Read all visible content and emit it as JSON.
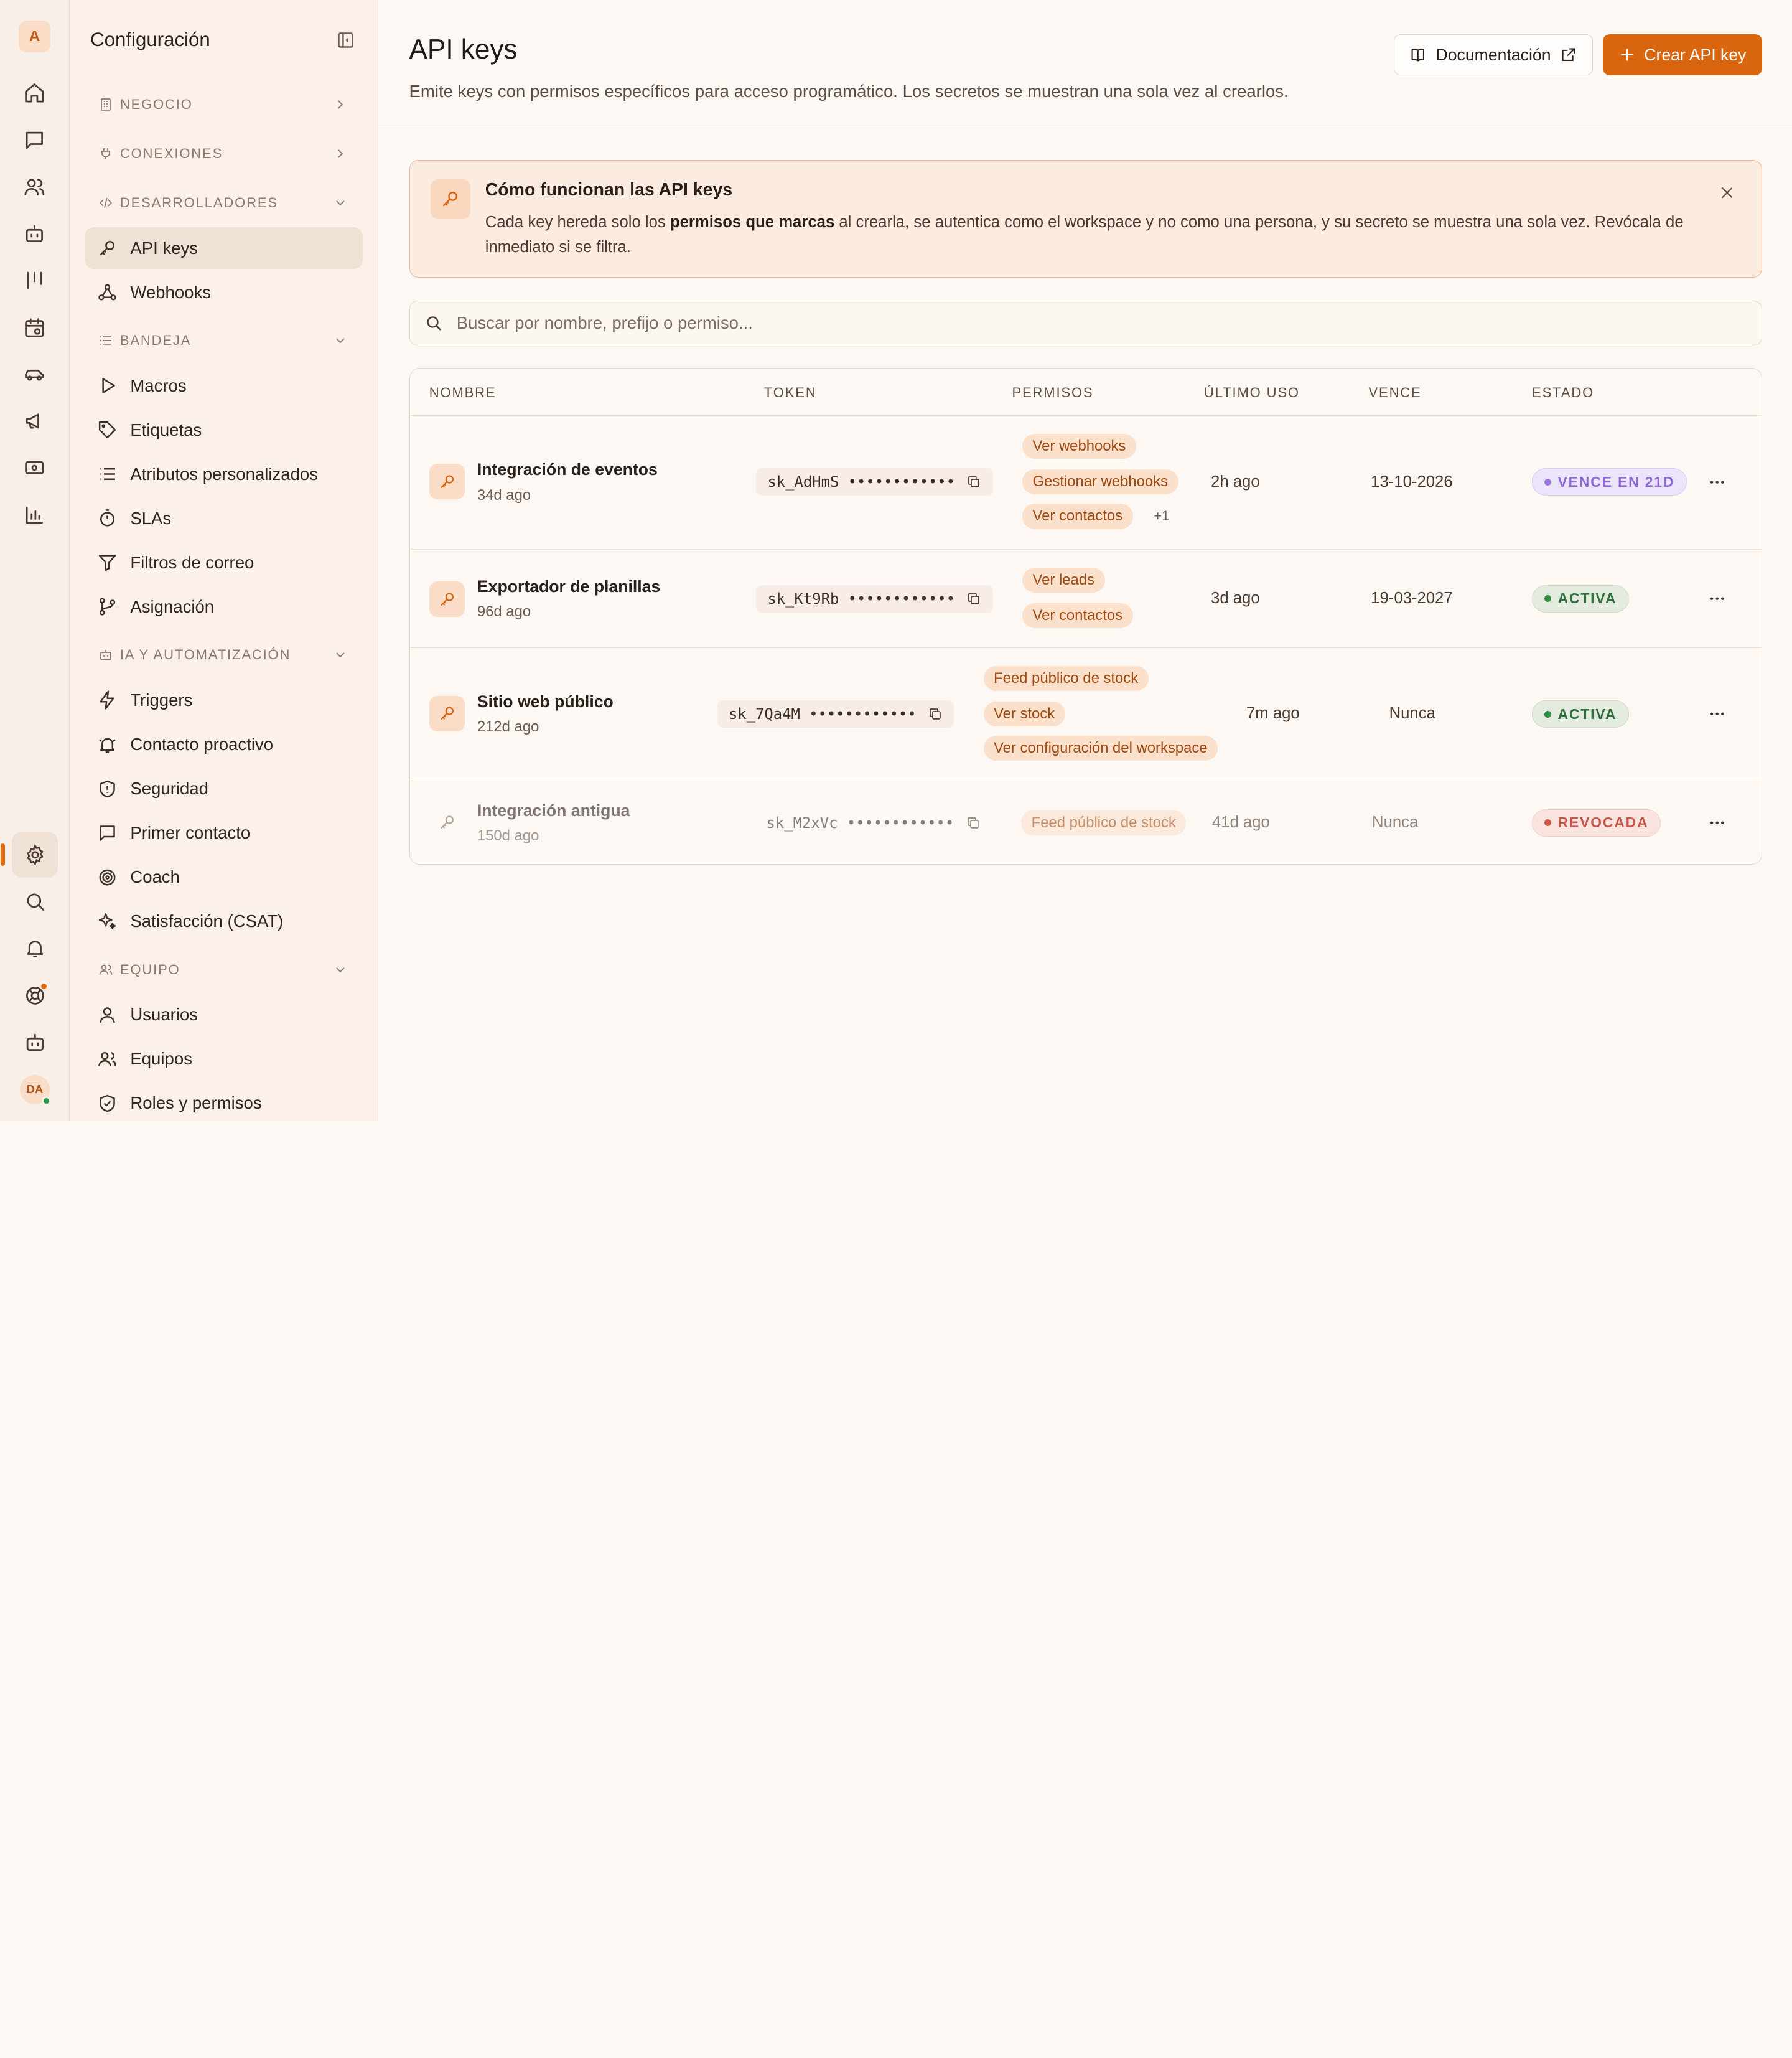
{
  "workspace": {
    "initial": "A"
  },
  "user": {
    "initials": "DA"
  },
  "sidebar": {
    "title": "Configuración",
    "sections": {
      "negocio": "NEGOCIO",
      "conexiones": "CONEXIONES",
      "desarrolladores": "DESARROLLADORES",
      "bandeja": "BANDEJA",
      "ia": "IA Y AUTOMATIZACIÓN",
      "equipo": "EQUIPO"
    },
    "items": {
      "api_keys": "API keys",
      "webhooks": "Webhooks",
      "macros": "Macros",
      "etiquetas": "Etiquetas",
      "atributos": "Atributos personalizados",
      "slas": "SLAs",
      "filtros": "Filtros de correo",
      "asignacion": "Asignación",
      "triggers": "Triggers",
      "contacto": "Contacto proactivo",
      "seguridad": "Seguridad",
      "primer": "Primer contacto",
      "coach": "Coach",
      "csat": "Satisfacción (CSAT)",
      "usuarios": "Usuarios",
      "equipos": "Equipos",
      "roles": "Roles y permisos"
    }
  },
  "header": {
    "title": "API keys",
    "subtitle": "Emite keys con permisos específicos para acceso programático. Los secretos se muestran una sola vez al crearlos.",
    "docs_label": "Documentación",
    "create_label": "Crear API key"
  },
  "info": {
    "title": "Cómo funcionan las API keys",
    "text_before": "Cada key hereda solo los ",
    "text_bold": "permisos que marcas",
    "text_after": " al crearla, se autentica como el workspace y no como una persona, y su secreto se muestra una sola vez. Revócala de inmediato si se filtra."
  },
  "search": {
    "placeholder": "Buscar por nombre, prefijo o permiso..."
  },
  "table": {
    "headers": {
      "nombre": "NOMBRE",
      "token": "TOKEN",
      "permisos": "PERMISOS",
      "ultimo_uso": "ÚLTIMO USO",
      "vence": "VENCE",
      "estado": "ESTADO"
    },
    "rows": [
      {
        "name": "Integración de eventos",
        "age": "34d ago",
        "token": "sk_AdHmS ••••••••••••",
        "perms": [
          "Ver webhooks",
          "Gestionar webhooks",
          "Ver contactos"
        ],
        "more": "+1",
        "last_used": "2h ago",
        "expires": "13-10-2026",
        "status": "VENCE EN 21D"
      },
      {
        "name": "Exportador de planillas",
        "age": "96d ago",
        "token": "sk_Kt9Rb ••••••••••••",
        "perms": [
          "Ver leads",
          "Ver contactos"
        ],
        "last_used": "3d ago",
        "expires": "19-03-2027",
        "status": "ACTIVA"
      },
      {
        "name": "Sitio web público",
        "age": "212d ago",
        "token": "sk_7Qa4M ••••••••••••",
        "perms": [
          "Feed público de stock",
          "Ver stock",
          "Ver configuración del workspace"
        ],
        "last_used": "7m ago",
        "expires": "Nunca",
        "status": "ACTIVA"
      },
      {
        "name": "Integración antigua",
        "age": "150d ago",
        "token": "sk_M2xVc ••••••••••••",
        "perms": [
          "Feed público de stock"
        ],
        "last_used": "41d ago",
        "expires": "Nunca",
        "status": "REVOCADA"
      }
    ]
  },
  "colors": {
    "accent": "#d9650f",
    "ok": "#2f8c45",
    "warn": "#9a78db",
    "bad": "#d0584b"
  }
}
